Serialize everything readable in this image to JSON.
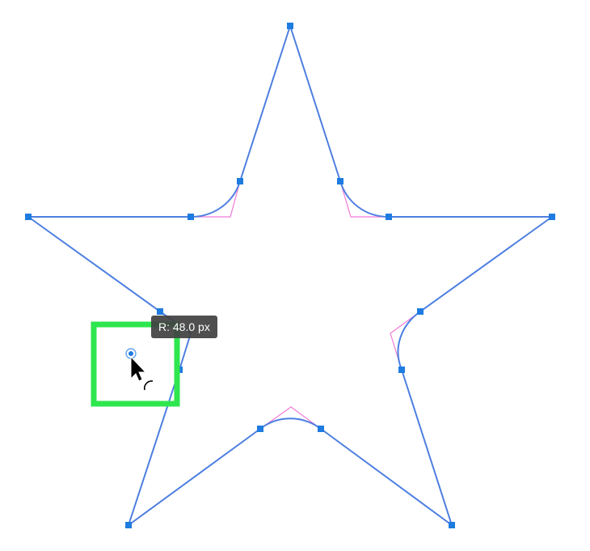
{
  "tooltip": {
    "text": "R: 48.0 px"
  },
  "colors": {
    "path": "#4d7fe0",
    "handle": "#1e7be0",
    "corner_guide": "#f07ad6",
    "highlight": "#2ee64d",
    "tooltip_bg": "#404040"
  },
  "icons": {
    "cursor": "arrow-cursor-icon",
    "corner_widget": "corner-radius-widget-icon",
    "rotate_hint": "arc-hint-icon"
  }
}
